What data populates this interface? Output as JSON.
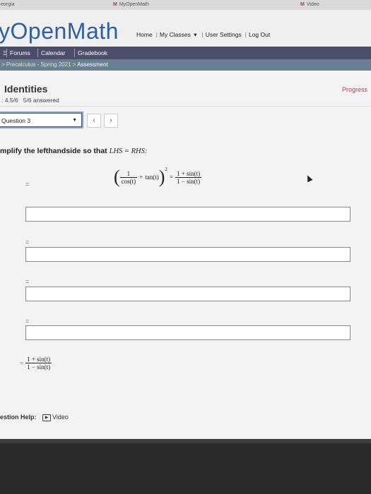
{
  "browser_tabs": [
    {
      "label": "eorgia",
      "icon": ""
    },
    {
      "label": "MyOpenMath",
      "icon": "M"
    },
    {
      "label": "Video",
      "icon": "M"
    }
  ],
  "header": {
    "logo": "yOpenMath",
    "nav": {
      "home": "Home",
      "my_classes": "My Classes",
      "user_settings": "User Settings",
      "logout": "Log Out",
      "dropdown_caret": "▾"
    }
  },
  "navbar": {
    "items": [
      "Forums",
      "Calendar",
      "Gradebook"
    ],
    "left_marker": "Ξ"
  },
  "breadcrumb": {
    "prefix": ">",
    "course": "Precalculus - Spring 2021",
    "sep": ">",
    "current": "Assessment"
  },
  "assessment": {
    "title": "Identities",
    "score": ": 4.5/6",
    "answered": "5/6 answered",
    "progress_label": "Progress"
  },
  "question_nav": {
    "selected": "Question 3",
    "prev": "‹",
    "next": "›"
  },
  "question": {
    "instruction_prefix": "mplify the lefthandside so that",
    "instruction_math": "LHS = RHS:",
    "lhs_numerator": "1",
    "lhs_denominator": "cos(t)",
    "lhs_term": "tan(t)",
    "exponent": "2",
    "equals": "=",
    "rhs_numerator": "1 + sin(t)",
    "rhs_denominator": "1 − sin(t)"
  },
  "answer_rows": [
    {
      "eq": "="
    },
    {
      "eq": "="
    },
    {
      "eq": "="
    },
    {
      "eq": "="
    }
  ],
  "final_step": {
    "eq": "=",
    "numerator": "1 + sin(t)",
    "denominator": "1 − sin(t)"
  },
  "help": {
    "label": "estion Help:",
    "video": "Video"
  }
}
